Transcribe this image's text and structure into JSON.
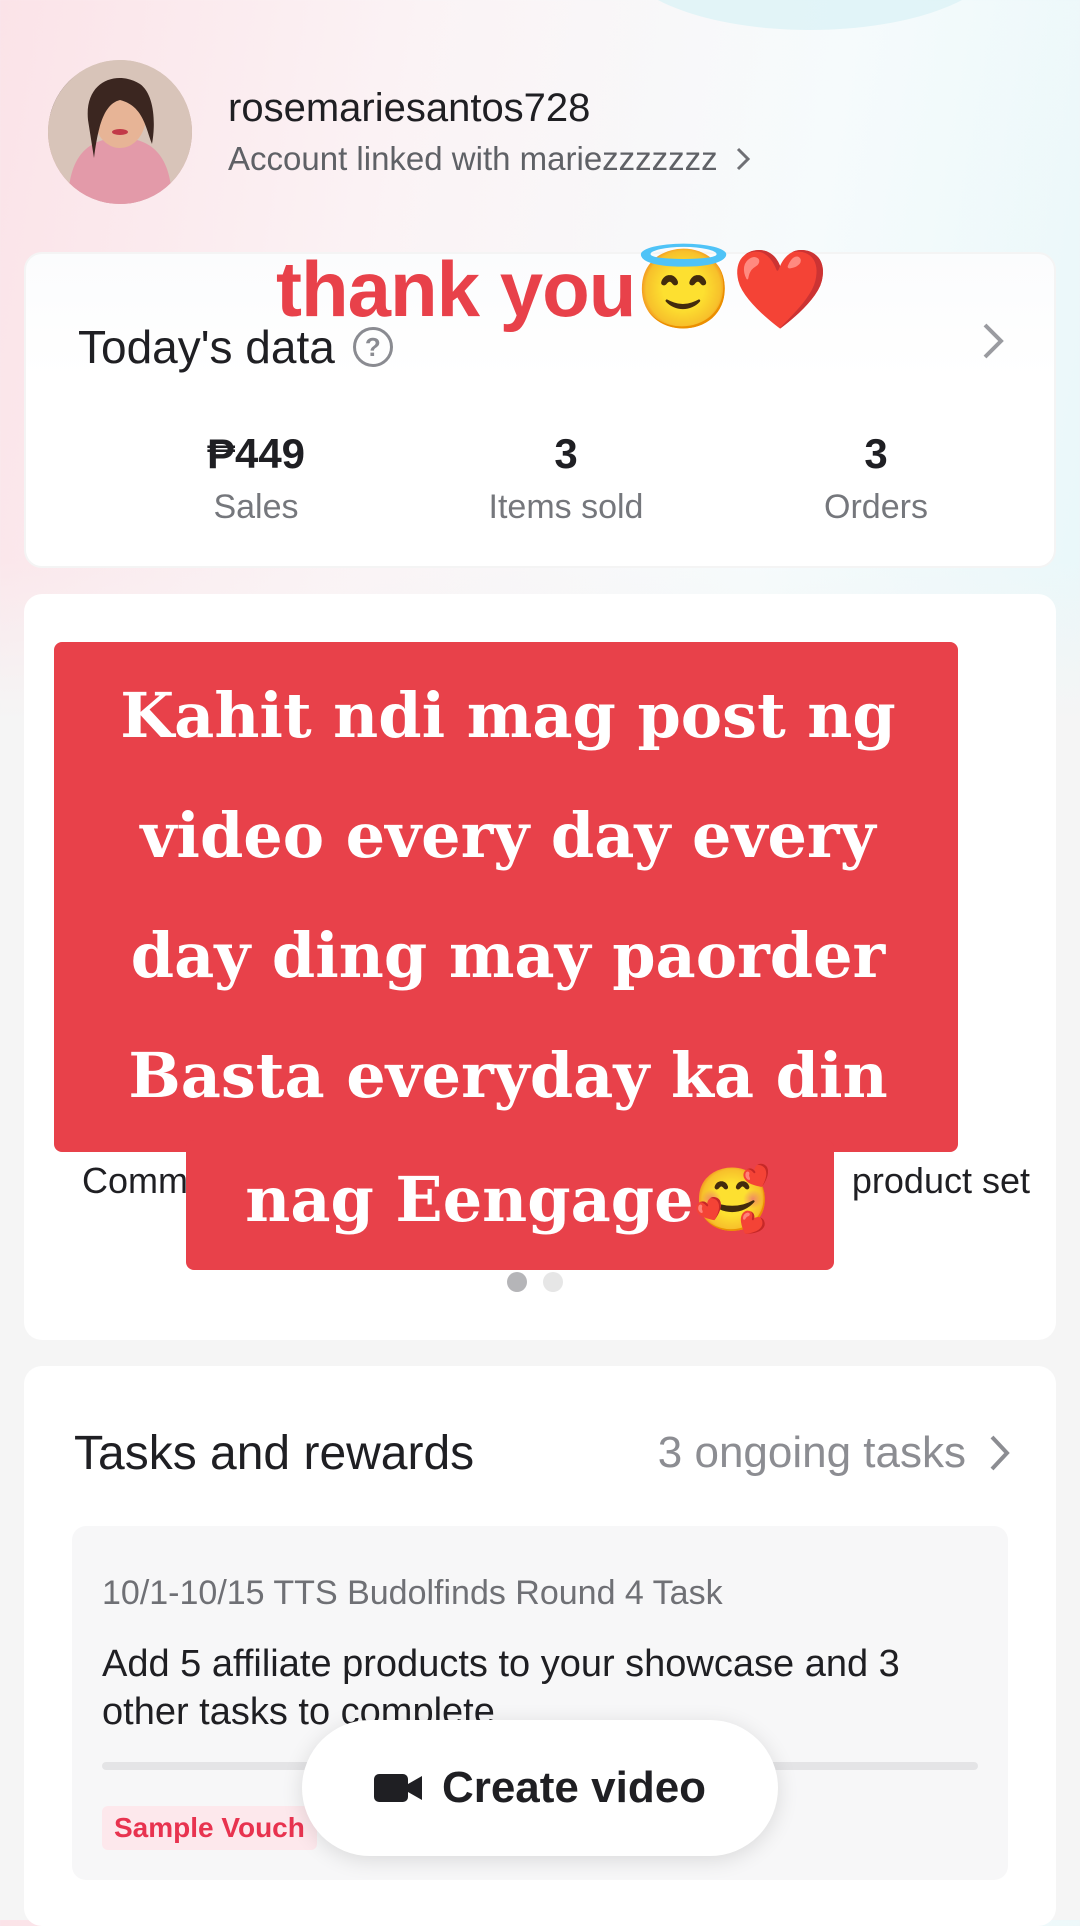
{
  "header": {
    "username": "rosemariesantos728",
    "linked_text": "Account linked with mariezzzzzzz"
  },
  "overlay_top": {
    "text": "thank you😇❤️"
  },
  "today": {
    "title": "Today's data",
    "stats": [
      {
        "value": "₱449",
        "label": "Sales"
      },
      {
        "value": "3",
        "label": "Items sold"
      },
      {
        "value": "3",
        "label": "Orders"
      }
    ]
  },
  "carousel": {
    "left_label": "Comm",
    "right_label": "product set",
    "dots_total": 2,
    "dots_active": 1
  },
  "caption": {
    "lines": [
      "Kahit ndi mag post ng",
      "video every day every",
      "day ding may paorder",
      "Basta everyday ka din",
      "nag Eengage🥰"
    ]
  },
  "tasks": {
    "title": "Tasks and rewards",
    "ongoing": "3 ongoing tasks",
    "task": {
      "subtitle": "10/1-10/15 TTS Budolfinds Round 4 Task",
      "description": "Add 5 affiliate products to your showcase and 3 other tasks to complete",
      "voucher_label": "Sample Vouch"
    }
  },
  "create_button": {
    "label": "Create video"
  },
  "colors": {
    "accent_red": "#e8414a",
    "voucher_red": "#e8334f"
  }
}
